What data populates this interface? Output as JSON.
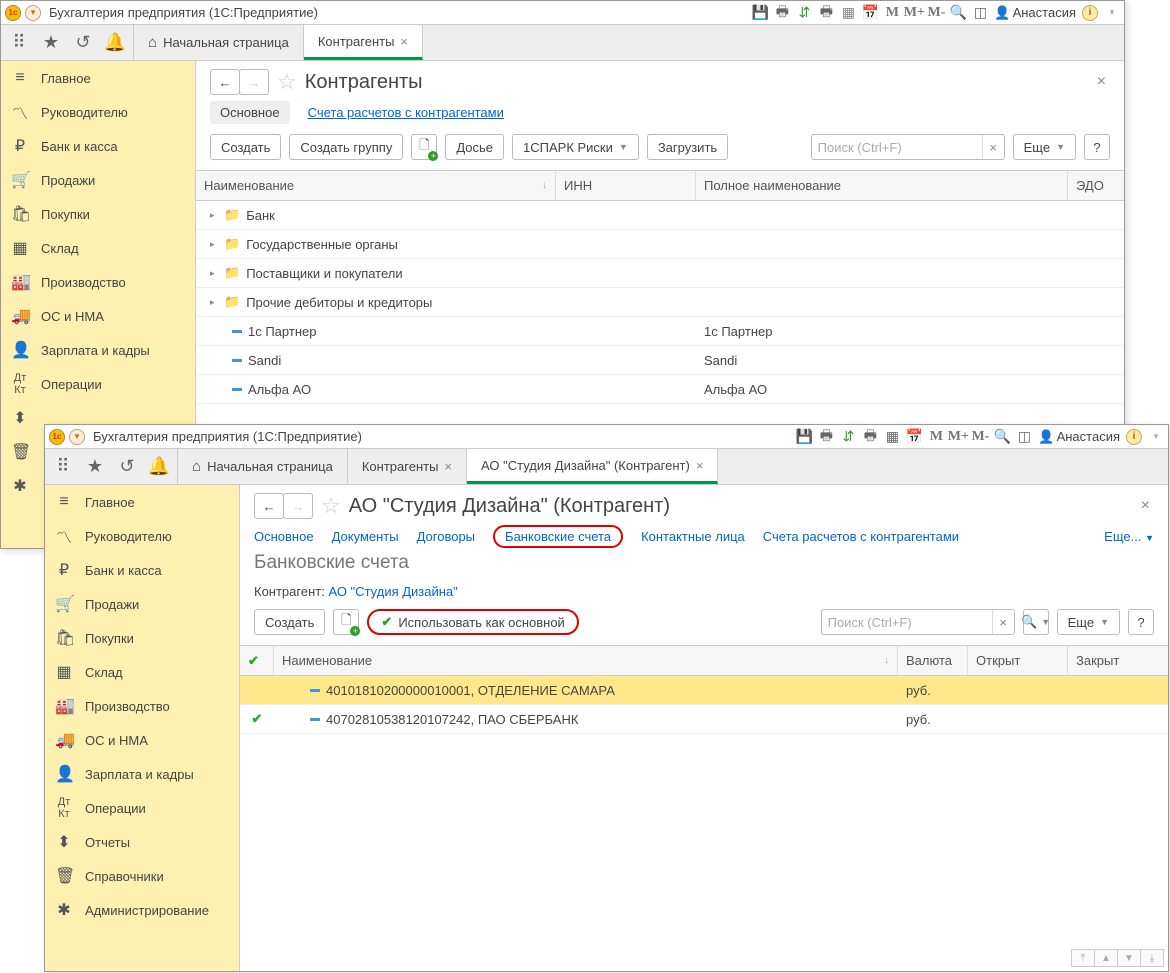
{
  "w1": {
    "title": "Бухгалтерия предприятия  (1С:Предприятие)",
    "user": "Анастасия",
    "toolbar_m": [
      "M",
      "M+",
      "M-"
    ],
    "tabs": {
      "home": "Начальная страница",
      "t1": "Контрагенты"
    },
    "nav": [
      "Главное",
      "Руководителю",
      "Банк и касса",
      "Продажи",
      "Покупки",
      "Склад",
      "Производство",
      "ОС и НМА",
      "Зарплата и кадры",
      "Операции"
    ],
    "page_title": "Контрагенты",
    "subtabs": {
      "main": "Основное",
      "accounts": "Счета расчетов с контрагентами"
    },
    "buttons": {
      "create": "Создать",
      "create_group": "Создать группу",
      "dossier": "Досье",
      "spark": "1СПАРК Риски",
      "upload": "Загрузить",
      "more": "Еще",
      "help": "?"
    },
    "search_ph": "Поиск (Ctrl+F)",
    "grid_head": {
      "name": "Наименование",
      "inn": "ИНН",
      "fullname": "Полное наименование",
      "edo": "ЭДО"
    },
    "folders": [
      "Банк",
      "Государственные органы",
      "Поставщики и покупатели",
      "Прочие дебиторы и кредиторы"
    ],
    "items": [
      {
        "name": "1с Партнер",
        "full": "1с Партнер"
      },
      {
        "name": "Sandi",
        "full": "Sandi"
      },
      {
        "name": "Альфа АО",
        "full": "Альфа АО"
      }
    ]
  },
  "w2": {
    "title": "Бухгалтерия предприятия  (1С:Предприятие)",
    "user": "Анастасия",
    "toolbar_m": [
      "M",
      "M+",
      "M-"
    ],
    "tabs": {
      "home": "Начальная страница",
      "t1": "Контрагенты",
      "t2": "АО \"Студия Дизайна\" (Контрагент)"
    },
    "nav": [
      "Главное",
      "Руководителю",
      "Банк и касса",
      "Продажи",
      "Покупки",
      "Склад",
      "Производство",
      "ОС и НМА",
      "Зарплата и кадры",
      "Операции",
      "Отчеты",
      "Справочники",
      "Администрирование"
    ],
    "page_title": "АО \"Студия Дизайна\" (Контрагент)",
    "subtabs": {
      "main": "Основное",
      "docs": "Документы",
      "contracts": "Договоры",
      "bank": "Банковские счета",
      "contacts": "Контактные лица",
      "accounts": "Счета расчетов с контрагентами",
      "more": "Еще..."
    },
    "section_title": "Банковские счета",
    "kv_label": "Контрагент:",
    "kv_value": "АО \"Студия Дизайна\"",
    "buttons": {
      "create": "Создать",
      "use_main": "Использовать как основной",
      "more": "Еще",
      "help": "?"
    },
    "search_ph": "Поиск (Ctrl+F)",
    "grid_head": {
      "name": "Наименование",
      "curr": "Валюта",
      "open": "Открыт",
      "close": "Закрыт"
    },
    "rows": [
      {
        "main": false,
        "name": "40101810200000010001, ОТДЕЛЕНИЕ САМАРА",
        "curr": "руб."
      },
      {
        "main": true,
        "name": "40702810538120107242, ПАО СБЕРБАНК",
        "curr": "руб."
      }
    ]
  },
  "nav_icons": [
    "≡",
    "↗",
    "₽",
    "🛒",
    "🛍",
    "▦",
    "🏭",
    "🚚",
    "👤",
    "ᴬᵀ",
    "⬍",
    "🗑",
    "✱"
  ],
  "nav_icons2": [
    "≡",
    "↗",
    "₽",
    "🛒",
    "🛍",
    "▦",
    "🏭",
    "🚚",
    "👤",
    "ᴬᵀ",
    "⬍",
    "🗑",
    "✱"
  ]
}
